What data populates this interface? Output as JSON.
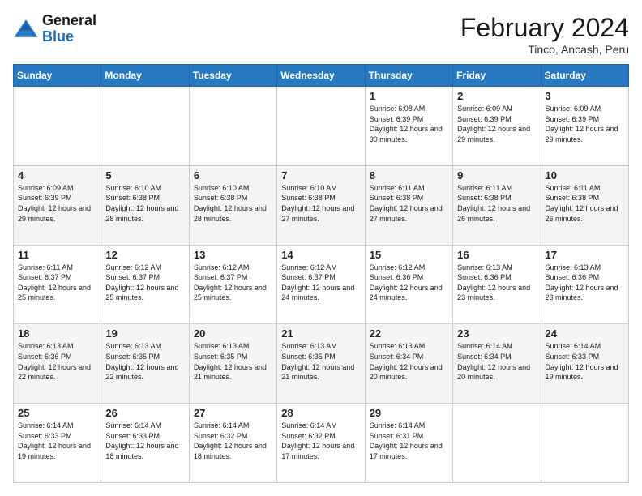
{
  "header": {
    "logo": {
      "general": "General",
      "blue": "Blue"
    },
    "title": "February 2024",
    "location": "Tinco, Ancash, Peru"
  },
  "days_of_week": [
    "Sunday",
    "Monday",
    "Tuesday",
    "Wednesday",
    "Thursday",
    "Friday",
    "Saturday"
  ],
  "weeks": [
    [
      {
        "day": "",
        "info": ""
      },
      {
        "day": "",
        "info": ""
      },
      {
        "day": "",
        "info": ""
      },
      {
        "day": "",
        "info": ""
      },
      {
        "day": "1",
        "info": "Sunrise: 6:08 AM\nSunset: 6:39 PM\nDaylight: 12 hours\nand 30 minutes."
      },
      {
        "day": "2",
        "info": "Sunrise: 6:09 AM\nSunset: 6:39 PM\nDaylight: 12 hours\nand 29 minutes."
      },
      {
        "day": "3",
        "info": "Sunrise: 6:09 AM\nSunset: 6:39 PM\nDaylight: 12 hours\nand 29 minutes."
      }
    ],
    [
      {
        "day": "4",
        "info": "Sunrise: 6:09 AM\nSunset: 6:39 PM\nDaylight: 12 hours\nand 29 minutes."
      },
      {
        "day": "5",
        "info": "Sunrise: 6:10 AM\nSunset: 6:38 PM\nDaylight: 12 hours\nand 28 minutes."
      },
      {
        "day": "6",
        "info": "Sunrise: 6:10 AM\nSunset: 6:38 PM\nDaylight: 12 hours\nand 28 minutes."
      },
      {
        "day": "7",
        "info": "Sunrise: 6:10 AM\nSunset: 6:38 PM\nDaylight: 12 hours\nand 27 minutes."
      },
      {
        "day": "8",
        "info": "Sunrise: 6:11 AM\nSunset: 6:38 PM\nDaylight: 12 hours\nand 27 minutes."
      },
      {
        "day": "9",
        "info": "Sunrise: 6:11 AM\nSunset: 6:38 PM\nDaylight: 12 hours\nand 26 minutes."
      },
      {
        "day": "10",
        "info": "Sunrise: 6:11 AM\nSunset: 6:38 PM\nDaylight: 12 hours\nand 26 minutes."
      }
    ],
    [
      {
        "day": "11",
        "info": "Sunrise: 6:11 AM\nSunset: 6:37 PM\nDaylight: 12 hours\nand 25 minutes."
      },
      {
        "day": "12",
        "info": "Sunrise: 6:12 AM\nSunset: 6:37 PM\nDaylight: 12 hours\nand 25 minutes."
      },
      {
        "day": "13",
        "info": "Sunrise: 6:12 AM\nSunset: 6:37 PM\nDaylight: 12 hours\nand 25 minutes."
      },
      {
        "day": "14",
        "info": "Sunrise: 6:12 AM\nSunset: 6:37 PM\nDaylight: 12 hours\nand 24 minutes."
      },
      {
        "day": "15",
        "info": "Sunrise: 6:12 AM\nSunset: 6:36 PM\nDaylight: 12 hours\nand 24 minutes."
      },
      {
        "day": "16",
        "info": "Sunrise: 6:13 AM\nSunset: 6:36 PM\nDaylight: 12 hours\nand 23 minutes."
      },
      {
        "day": "17",
        "info": "Sunrise: 6:13 AM\nSunset: 6:36 PM\nDaylight: 12 hours\nand 23 minutes."
      }
    ],
    [
      {
        "day": "18",
        "info": "Sunrise: 6:13 AM\nSunset: 6:36 PM\nDaylight: 12 hours\nand 22 minutes."
      },
      {
        "day": "19",
        "info": "Sunrise: 6:13 AM\nSunset: 6:35 PM\nDaylight: 12 hours\nand 22 minutes."
      },
      {
        "day": "20",
        "info": "Sunrise: 6:13 AM\nSunset: 6:35 PM\nDaylight: 12 hours\nand 21 minutes."
      },
      {
        "day": "21",
        "info": "Sunrise: 6:13 AM\nSunset: 6:35 PM\nDaylight: 12 hours\nand 21 minutes."
      },
      {
        "day": "22",
        "info": "Sunrise: 6:13 AM\nSunset: 6:34 PM\nDaylight: 12 hours\nand 20 minutes."
      },
      {
        "day": "23",
        "info": "Sunrise: 6:14 AM\nSunset: 6:34 PM\nDaylight: 12 hours\nand 20 minutes."
      },
      {
        "day": "24",
        "info": "Sunrise: 6:14 AM\nSunset: 6:33 PM\nDaylight: 12 hours\nand 19 minutes."
      }
    ],
    [
      {
        "day": "25",
        "info": "Sunrise: 6:14 AM\nSunset: 6:33 PM\nDaylight: 12 hours\nand 19 minutes."
      },
      {
        "day": "26",
        "info": "Sunrise: 6:14 AM\nSunset: 6:33 PM\nDaylight: 12 hours\nand 18 minutes."
      },
      {
        "day": "27",
        "info": "Sunrise: 6:14 AM\nSunset: 6:32 PM\nDaylight: 12 hours\nand 18 minutes."
      },
      {
        "day": "28",
        "info": "Sunrise: 6:14 AM\nSunset: 6:32 PM\nDaylight: 12 hours\nand 17 minutes."
      },
      {
        "day": "29",
        "info": "Sunrise: 6:14 AM\nSunset: 6:31 PM\nDaylight: 12 hours\nand 17 minutes."
      },
      {
        "day": "",
        "info": ""
      },
      {
        "day": "",
        "info": ""
      }
    ]
  ]
}
